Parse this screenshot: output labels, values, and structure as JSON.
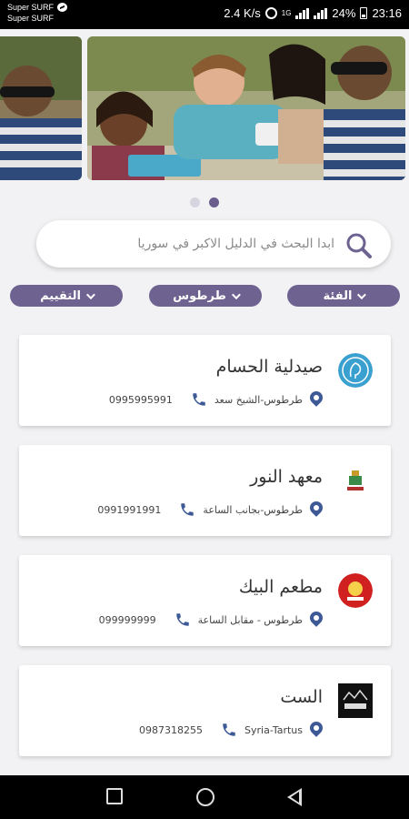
{
  "status_bar": {
    "notif_line1": "Super SURF",
    "notif_line2": "Super SURF",
    "speed": "2.4 K/s",
    "network": "1G",
    "battery": "24%",
    "time": "23:16"
  },
  "search": {
    "placeholder": "ابدا البحث في الدليل الاكبر في سوريا"
  },
  "filters": {
    "category": "الفئة",
    "city": "طرطوس",
    "rating": "التقييم"
  },
  "listings": [
    {
      "name": "صيدلية الحسام",
      "address": "طرطوس-الشيخ سعد",
      "phone": "0995995991",
      "logo": "pharmacy-logo"
    },
    {
      "name": "معهد النور",
      "address": "طرطوس-بجانب الساعة",
      "phone": "0991991991",
      "logo": "institute-logo"
    },
    {
      "name": "مطعم البيك",
      "address": "طرطوس - مقابل الساعة",
      "phone": "099999999",
      "logo": "restaurant-logo"
    },
    {
      "name": "الست",
      "address": "Syria-Tartus",
      "phone": "0987318255",
      "logo": "store-logo"
    }
  ],
  "colors": {
    "accent": "#6e6290",
    "icon_blue": "#3d5a96"
  },
  "pager": {
    "count": 2,
    "active": 2
  }
}
